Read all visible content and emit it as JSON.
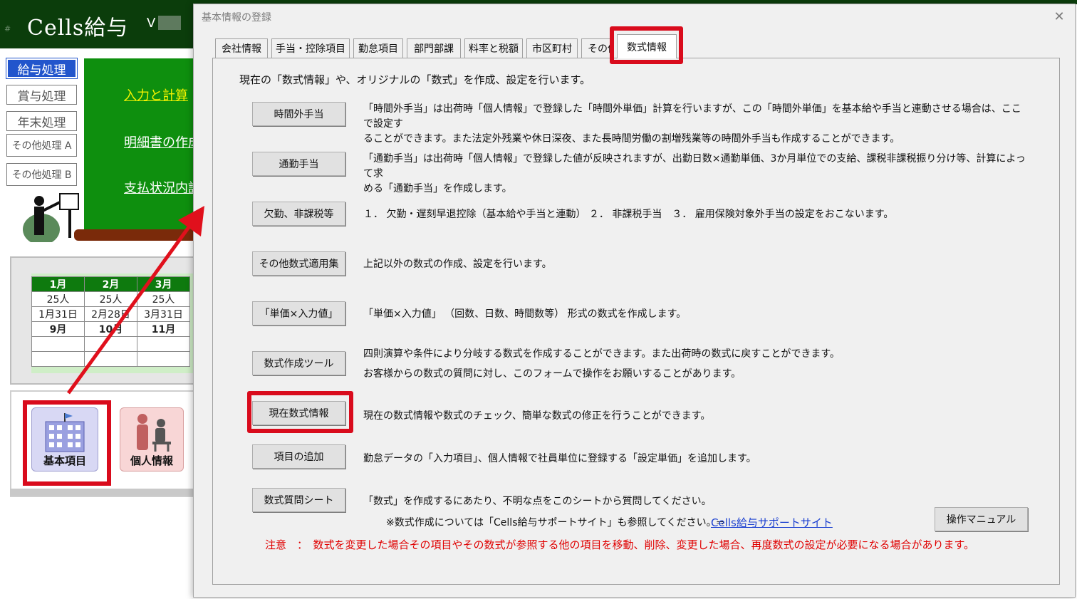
{
  "app": {
    "title": "Cells給与",
    "version_prefix": "V",
    "hash": "#",
    "side_buttons": [
      "給与処理",
      "賞与処理",
      "年末処理",
      "その他処理 A",
      "その他処理 B"
    ],
    "board_links": [
      "入力と計算",
      "明細書の作成",
      "支払状況内訳"
    ],
    "calendar": {
      "months": [
        "1月",
        "2月",
        "3月"
      ],
      "counts": [
        "25人",
        "25人",
        "25人"
      ],
      "dates": [
        "1月31日",
        "2月28日",
        "3月31日"
      ],
      "next_months": [
        "9月",
        "10月",
        "11月"
      ]
    },
    "tray_icons": {
      "basic": "基本項目",
      "person": "個人情報"
    }
  },
  "dialog": {
    "title": "基本情報の登録",
    "close_glyph": "✕",
    "tabs": [
      "会社情報",
      "手当・控除項目",
      "勤怠項目",
      "部門部課",
      "料率と税額",
      "市区町村",
      "その他",
      "数式情報"
    ],
    "active_tab": "数式情報",
    "intro": "現在の「数式情報」や、オリジナルの「数式」を作成、設定を行います。",
    "items": [
      {
        "button": "時間外手当",
        "desc_lines": [
          "「時間外手当」は出荷時「個人情報」で登録した「時間外単価」計算を行いますが、この「時間外単価」を基本給や手当と連動させる場合は、ここで設定す",
          "ることができます。また法定外残業や休日深夜、また長時間労働の割増残業等の時間外手当も作成することができます。"
        ]
      },
      {
        "button": "通勤手当",
        "desc_lines": [
          "「通勤手当」は出荷時「個人情報」で登録した値が反映されますが、出勤日数×通勤単価、3か月単位での支給、課税非課税振り分け等、計算によって求",
          "める「通勤手当」を作成します。"
        ]
      },
      {
        "button": "欠勤、非課税等",
        "desc_lines": [
          "１． 欠勤・遅刻早退控除（基本給や手当と連動） ２． 非課税手当　３． 雇用保険対象外手当の設定をおこないます。"
        ]
      },
      {
        "button": "その他数式適用集",
        "desc_lines": [
          "上記以外の数式の作成、設定を行います。"
        ]
      },
      {
        "button": "「単価×入力値」",
        "desc_lines": [
          "「単価×入力値」 （回数、日数、時間数等） 形式の数式を作成します。"
        ]
      },
      {
        "button": "数式作成ツール",
        "desc_lines": [
          "四則演算や条件により分岐する数式を作成することができます。また出荷時の数式に戻すことができます。",
          "お客様からの数式の質問に対し、このフォームで操作をお願いすることがあります。"
        ]
      },
      {
        "button": "現在数式情報",
        "desc_lines": [
          "現在の数式情報や数式のチェック、簡単な数式の修正を行うことができます。"
        ]
      },
      {
        "button": "項目の追加",
        "desc_lines": [
          "勤怠データの「入力項目」、個人情報で社員単位に登録する「設定単価」を追加します。"
        ]
      },
      {
        "button": "数式質問シート",
        "desc_lines": [
          "「数式」を作成するにあたり、不明な点をこのシートから質問してください。"
        ]
      }
    ],
    "support_note": "※数式作成については「Cells給与サポートサイト」も参照してください。⇒",
    "support_link": "Cells給与サポートサイト",
    "manual_button": "操作マニュアル",
    "warning": "注意　：　数式を変更した場合その項目やその数式が参照する他の項目を移動、削除、変更した場合、再度数式の設定が必要になる場合があります。"
  },
  "colors": {
    "highlight_red": "#d90b1c",
    "board_green": "#0e8f0e",
    "header_green": "#0b3d0b",
    "link_blue": "#1a3fd0",
    "warning_red": "#e00000"
  }
}
